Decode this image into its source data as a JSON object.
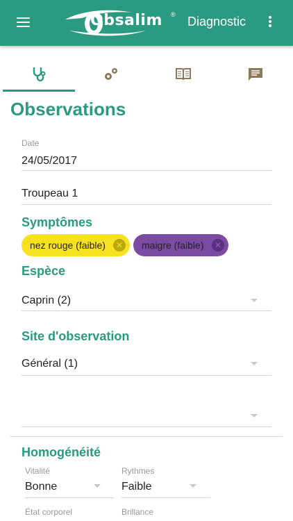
{
  "app": {
    "brand": "Obsalim",
    "trademark": "®",
    "title": "Diagnostic"
  },
  "colors": {
    "primary": "#2a9a80",
    "chip_yellow": "#f7e120",
    "chip_purple": "#7b4ba3"
  },
  "tabs": [
    {
      "icon": "stethoscope-icon",
      "active": true
    },
    {
      "icon": "gears-icon",
      "active": false
    },
    {
      "icon": "book-icon",
      "active": false
    },
    {
      "icon": "comment-icon",
      "active": false
    }
  ],
  "page": {
    "title": "Observations"
  },
  "date": {
    "label": "Date",
    "value": "24/05/2017"
  },
  "herd": {
    "value": "Troupeau 1"
  },
  "symptoms": {
    "label": "Symptômes",
    "chips": [
      {
        "text": "nez rouge (faible)",
        "color": "yellow"
      },
      {
        "text": "maigre (faible)",
        "color": "purple"
      }
    ]
  },
  "species": {
    "label": "Espèce",
    "value": "Caprin (2)"
  },
  "site": {
    "label": "Site d'observation",
    "value": "Général (1)"
  },
  "empty_select": {
    "value": ""
  },
  "homogeneity": {
    "label": "Homogénéité",
    "vitality": {
      "label": "Vitalité",
      "value": "Bonne"
    },
    "rhythms": {
      "label": "Rythmes",
      "value": "Faible"
    },
    "body_state": {
      "label": "État corporel"
    },
    "shine": {
      "label": "Brillance"
    }
  }
}
